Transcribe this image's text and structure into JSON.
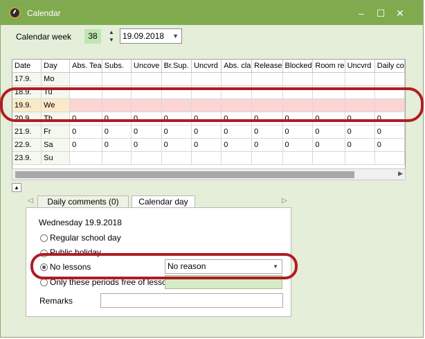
{
  "window": {
    "title": "Calendar",
    "buttons": {
      "minimize": "–",
      "maximize": "☐",
      "close": "✕"
    }
  },
  "toolbar": {
    "week_label": "Calendar week",
    "week_value": "38",
    "date_value": "19.09.2018"
  },
  "grid": {
    "columns": [
      "Date",
      "Day",
      "Abs. Tea",
      "Subs.",
      "Uncove",
      "Br.Sup.",
      "Uncvrd",
      "Abs. cla",
      "Release",
      "Blocked",
      "Room re",
      "Uncvrd",
      "Daily co"
    ],
    "rows": [
      [
        "17.9.",
        "Mo",
        "",
        "",
        "",
        "",
        "",
        "",
        "",
        "",
        "",
        "",
        ""
      ],
      [
        "18.9.",
        "Tu",
        "",
        "",
        "",
        "",
        "",
        "",
        "",
        "",
        "",
        "",
        ""
      ],
      [
        "19.9.",
        "We",
        "",
        "",
        "",
        "",
        "",
        "",
        "",
        "",
        "",
        "",
        ""
      ],
      [
        "20.9.",
        "Th",
        "0",
        "0",
        "0",
        "0",
        "0",
        "0",
        "0",
        "0",
        "0",
        "0",
        "0"
      ],
      [
        "21.9.",
        "Fr",
        "0",
        "0",
        "0",
        "0",
        "0",
        "0",
        "0",
        "0",
        "0",
        "0",
        "0"
      ],
      [
        "22.9.",
        "Sa",
        "0",
        "0",
        "0",
        "0",
        "0",
        "0",
        "0",
        "0",
        "0",
        "0",
        "0"
      ],
      [
        "23.9.",
        "Su",
        "",
        "",
        "",
        "",
        "",
        "",
        "",
        "",
        "",
        "",
        ""
      ]
    ],
    "selected_row": 2
  },
  "tabs": [
    {
      "label": "Daily comments (0)"
    },
    {
      "label": "Calendar day"
    }
  ],
  "calendar_day": {
    "heading": "Wednesday 19.9.2018",
    "option_regular": "Regular school day",
    "option_holiday": "Public holiday",
    "option_no_lessons": "No lessons",
    "option_periods_free": "Only these periods free of lessons",
    "reason_value": "No reason",
    "remarks_label": "Remarks"
  },
  "colors": {
    "titlebar": "#7faa4e",
    "highlight": "#b01c24",
    "selected_row": "#fbd4d4"
  }
}
